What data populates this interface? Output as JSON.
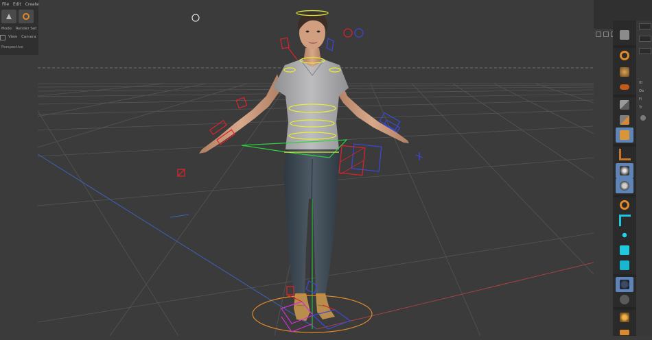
{
  "left_panel": {
    "menu": [
      "File",
      "Edit",
      "Create"
    ],
    "sub_row1": [
      "Mode",
      "Render Set"
    ],
    "sub_row2": [
      "View",
      "Camera"
    ],
    "viewport_label": "Perspective"
  },
  "colors": {
    "background": "#3b3b3b",
    "grid": "#5a5a5a",
    "rig_yellow": "#e8ef2c",
    "rig_red": "#e0222b",
    "rig_blue": "#3b49d8",
    "rig_magenta": "#d02fd6",
    "rig_orange": "#e28a2a",
    "rig_green": "#2bd33f",
    "axis_blue": "#3d63b8",
    "axis_red": "#b04040",
    "toolbar_active": "#5f84b8"
  },
  "viewport": {
    "scene": "3D character rig in T-pose",
    "shirt_color": "#b0b0b2",
    "jeans_color": "#3d4853",
    "skin_color": "#d29e80",
    "hair_color": "#3b2e26",
    "shoe_color": "#b98d4c"
  },
  "toolbar": {
    "icons": [
      "cube-icon",
      "orange-gear-icon",
      "sphere-blend-icon",
      "pill-icon",
      "pen-icon",
      "spline-icon",
      "cube-select-icon",
      "bend-icon",
      "mograph-icon",
      "light-icon",
      "cloner-icon",
      "fracture-icon",
      "cyan-cube-icon",
      "cyan-sphere-icon",
      "field-icon",
      "camera-icon",
      "render-icon",
      "orange-shape-icon"
    ]
  },
  "attr_panel": {
    "labels": [
      "ID",
      "Ob",
      "Fi",
      "Tr"
    ]
  }
}
